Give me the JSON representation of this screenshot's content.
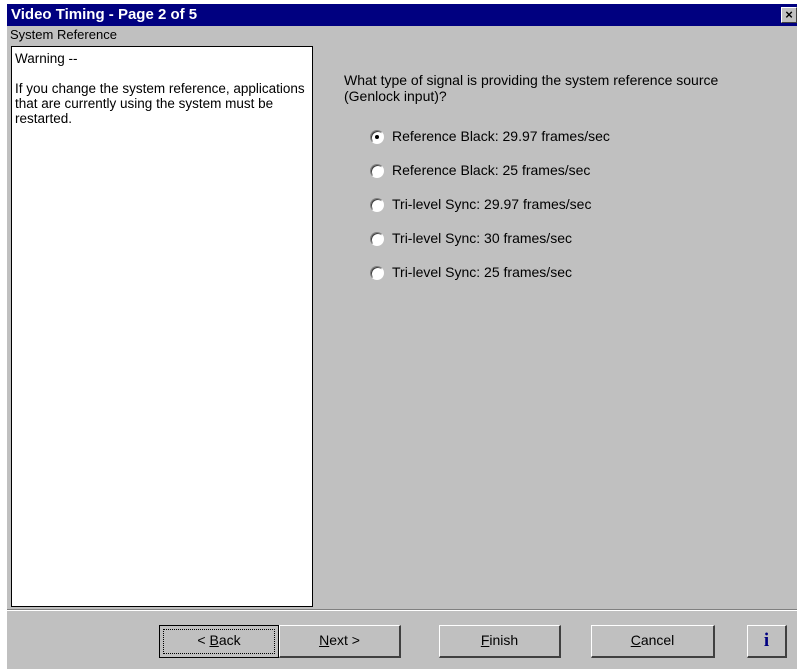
{
  "window": {
    "title": "Video Timing - Page 2 of 5",
    "close_glyph": "×"
  },
  "section_label": "System Reference",
  "warning": {
    "title": "Warning --",
    "body": "If you change the system reference, applications that are currently using the system must be restarted."
  },
  "question": "What type of signal is providing the system reference source (Genlock input)?",
  "options": [
    {
      "label": "Reference Black: 29.97 frames/sec",
      "selected": true
    },
    {
      "label": "Reference Black: 25 frames/sec",
      "selected": false
    },
    {
      "label": "Tri-level Sync: 29.97 frames/sec",
      "selected": false
    },
    {
      "label": "Tri-level Sync: 30 frames/sec",
      "selected": false
    },
    {
      "label": "Tri-level Sync: 25 frames/sec",
      "selected": false
    }
  ],
  "buttons": {
    "back": {
      "prefix": "< ",
      "mnemonic": "B",
      "rest": "ack"
    },
    "next": {
      "prefix": "",
      "mnemonic": "N",
      "rest": "ext >"
    },
    "finish": {
      "prefix": "",
      "mnemonic": "F",
      "rest": "inish"
    },
    "cancel": {
      "prefix": "",
      "mnemonic": "C",
      "rest": "ancel"
    },
    "info": {
      "glyph": "i",
      "icon": "info-icon"
    }
  },
  "colors": {
    "titlebar": "#000080",
    "face": "#c0c0c0",
    "pane": "#ffffff"
  }
}
